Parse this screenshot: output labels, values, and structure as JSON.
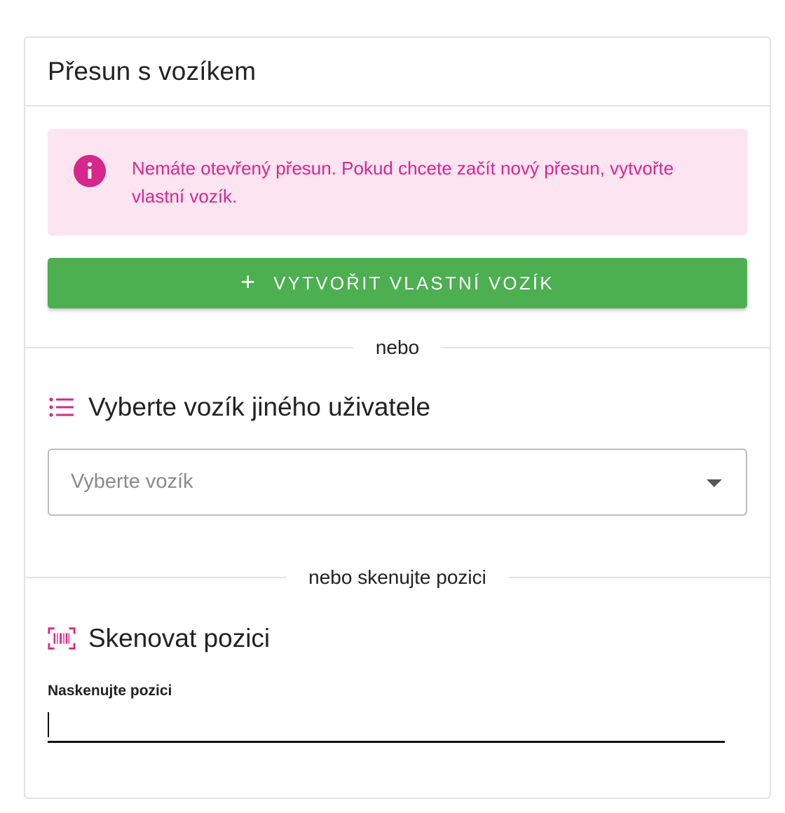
{
  "card": {
    "title": "Přesun s vozíkem"
  },
  "alert": {
    "icon": "info-icon",
    "message": "Nemáte otevřený přesun. Pokud chcete začít nový přesun, vytvořte vlastní vozík.",
    "color": "#d6278d",
    "background": "#fce4f1"
  },
  "create_button": {
    "icon": "plus-icon",
    "label": "VYTVOŘIT VLASTNÍ VOZÍK",
    "color": "#4caf50"
  },
  "divider_or": {
    "text": "nebo"
  },
  "other_user_section": {
    "icon": "list-icon",
    "title": "Vyberte vozík jiného uživatele",
    "select_placeholder": "Vyberte vozík"
  },
  "divider_scan": {
    "text": "nebo skenujte pozici"
  },
  "scan_section": {
    "icon": "barcode-scan-icon",
    "title": "Skenovat pozici",
    "field_label": "Naskenujte pozici",
    "field_value": ""
  },
  "accent_color": "#d6278d"
}
